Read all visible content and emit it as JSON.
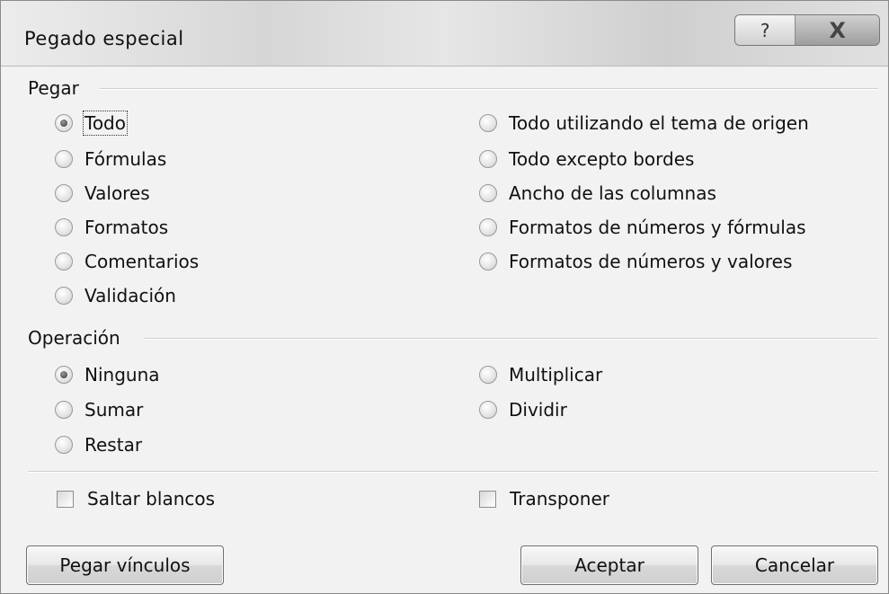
{
  "dialog": {
    "title": "Pegado especial",
    "help_glyph": "?",
    "close_glyph": "X"
  },
  "pegar": {
    "label": "Pegar",
    "options_left": [
      {
        "label": "Todo",
        "selected": true
      },
      {
        "label": "Fórmulas",
        "selected": false
      },
      {
        "label": "Valores",
        "selected": false
      },
      {
        "label": "Formatos",
        "selected": false
      },
      {
        "label": "Comentarios",
        "selected": false
      },
      {
        "label": "Validación",
        "selected": false
      }
    ],
    "options_right": [
      {
        "label": "Todo utilizando el tema de origen",
        "selected": false
      },
      {
        "label": "Todo excepto bordes",
        "selected": false
      },
      {
        "label": "Ancho de las columnas",
        "selected": false
      },
      {
        "label": "Formatos de números y fórmulas",
        "selected": false
      },
      {
        "label": "Formatos de números y valores",
        "selected": false
      }
    ]
  },
  "operacion": {
    "label": "Operación",
    "options_left": [
      {
        "label": "Ninguna",
        "selected": true
      },
      {
        "label": "Sumar",
        "selected": false
      },
      {
        "label": "Restar",
        "selected": false
      }
    ],
    "options_right": [
      {
        "label": "Multiplicar",
        "selected": false
      },
      {
        "label": "Dividir",
        "selected": false
      }
    ]
  },
  "checkboxes": {
    "saltar_blancos": {
      "label": "Saltar blancos",
      "checked": false
    },
    "transponer": {
      "label": "Transponer",
      "checked": false
    }
  },
  "buttons": {
    "pegar_vinculos": "Pegar vínculos",
    "aceptar": "Aceptar",
    "cancelar": "Cancelar"
  }
}
